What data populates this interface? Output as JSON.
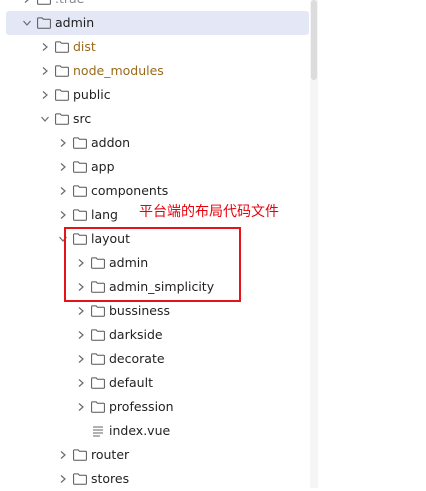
{
  "explorer": {
    "items": [
      {
        "label": ".trae",
        "depth": 0,
        "expanded": false,
        "kind": "folder",
        "style": "dim",
        "icon": "folder-icon"
      },
      {
        "label": "admin",
        "depth": 0,
        "expanded": true,
        "kind": "folder",
        "style": "normal",
        "selected": true,
        "icon": "folder-icon"
      },
      {
        "label": "dist",
        "depth": 1,
        "expanded": false,
        "kind": "folder",
        "style": "ignored",
        "icon": "folder-icon"
      },
      {
        "label": "node_modules",
        "depth": 1,
        "expanded": false,
        "kind": "folder",
        "style": "ignored",
        "icon": "folder-icon"
      },
      {
        "label": "public",
        "depth": 1,
        "expanded": false,
        "kind": "folder",
        "style": "normal",
        "icon": "folder-icon"
      },
      {
        "label": "src",
        "depth": 1,
        "expanded": true,
        "kind": "folder",
        "style": "normal",
        "icon": "folder-icon"
      },
      {
        "label": "addon",
        "depth": 2,
        "expanded": false,
        "kind": "folder",
        "style": "normal",
        "icon": "folder-icon"
      },
      {
        "label": "app",
        "depth": 2,
        "expanded": false,
        "kind": "folder",
        "style": "normal",
        "icon": "folder-icon"
      },
      {
        "label": "components",
        "depth": 2,
        "expanded": false,
        "kind": "folder",
        "style": "normal",
        "icon": "folder-icon"
      },
      {
        "label": "lang",
        "depth": 2,
        "expanded": false,
        "kind": "folder",
        "style": "normal",
        "icon": "folder-icon"
      },
      {
        "label": "layout",
        "depth": 2,
        "expanded": true,
        "kind": "folder",
        "style": "normal",
        "icon": "folder-icon"
      },
      {
        "label": "admin",
        "depth": 3,
        "expanded": false,
        "kind": "folder",
        "style": "normal",
        "icon": "folder-icon"
      },
      {
        "label": "admin_simplicity",
        "depth": 3,
        "expanded": false,
        "kind": "folder",
        "style": "normal",
        "icon": "folder-icon"
      },
      {
        "label": "bussiness",
        "depth": 3,
        "expanded": false,
        "kind": "folder",
        "style": "normal",
        "icon": "folder-icon"
      },
      {
        "label": "darkside",
        "depth": 3,
        "expanded": false,
        "kind": "folder",
        "style": "normal",
        "icon": "folder-icon"
      },
      {
        "label": "decorate",
        "depth": 3,
        "expanded": false,
        "kind": "folder",
        "style": "normal",
        "icon": "folder-icon"
      },
      {
        "label": "default",
        "depth": 3,
        "expanded": false,
        "kind": "folder",
        "style": "normal",
        "icon": "folder-icon"
      },
      {
        "label": "profession",
        "depth": 3,
        "expanded": false,
        "kind": "folder",
        "style": "normal",
        "icon": "folder-icon"
      },
      {
        "label": "index.vue",
        "depth": 3,
        "expanded": null,
        "kind": "file",
        "style": "normal",
        "icon": "file-lines-icon"
      },
      {
        "label": "router",
        "depth": 2,
        "expanded": false,
        "kind": "folder",
        "style": "normal",
        "icon": "folder-icon"
      },
      {
        "label": "stores",
        "depth": 2,
        "expanded": false,
        "kind": "folder",
        "style": "normal",
        "icon": "folder-icon"
      }
    ]
  },
  "annotation": {
    "text": "平台端的布局代码文件",
    "color": "#e8000b"
  },
  "colors": {
    "selected_row": "#e4e8f6",
    "ignored_text": "#9a6a1a",
    "highlight_border": "#e3141a"
  }
}
